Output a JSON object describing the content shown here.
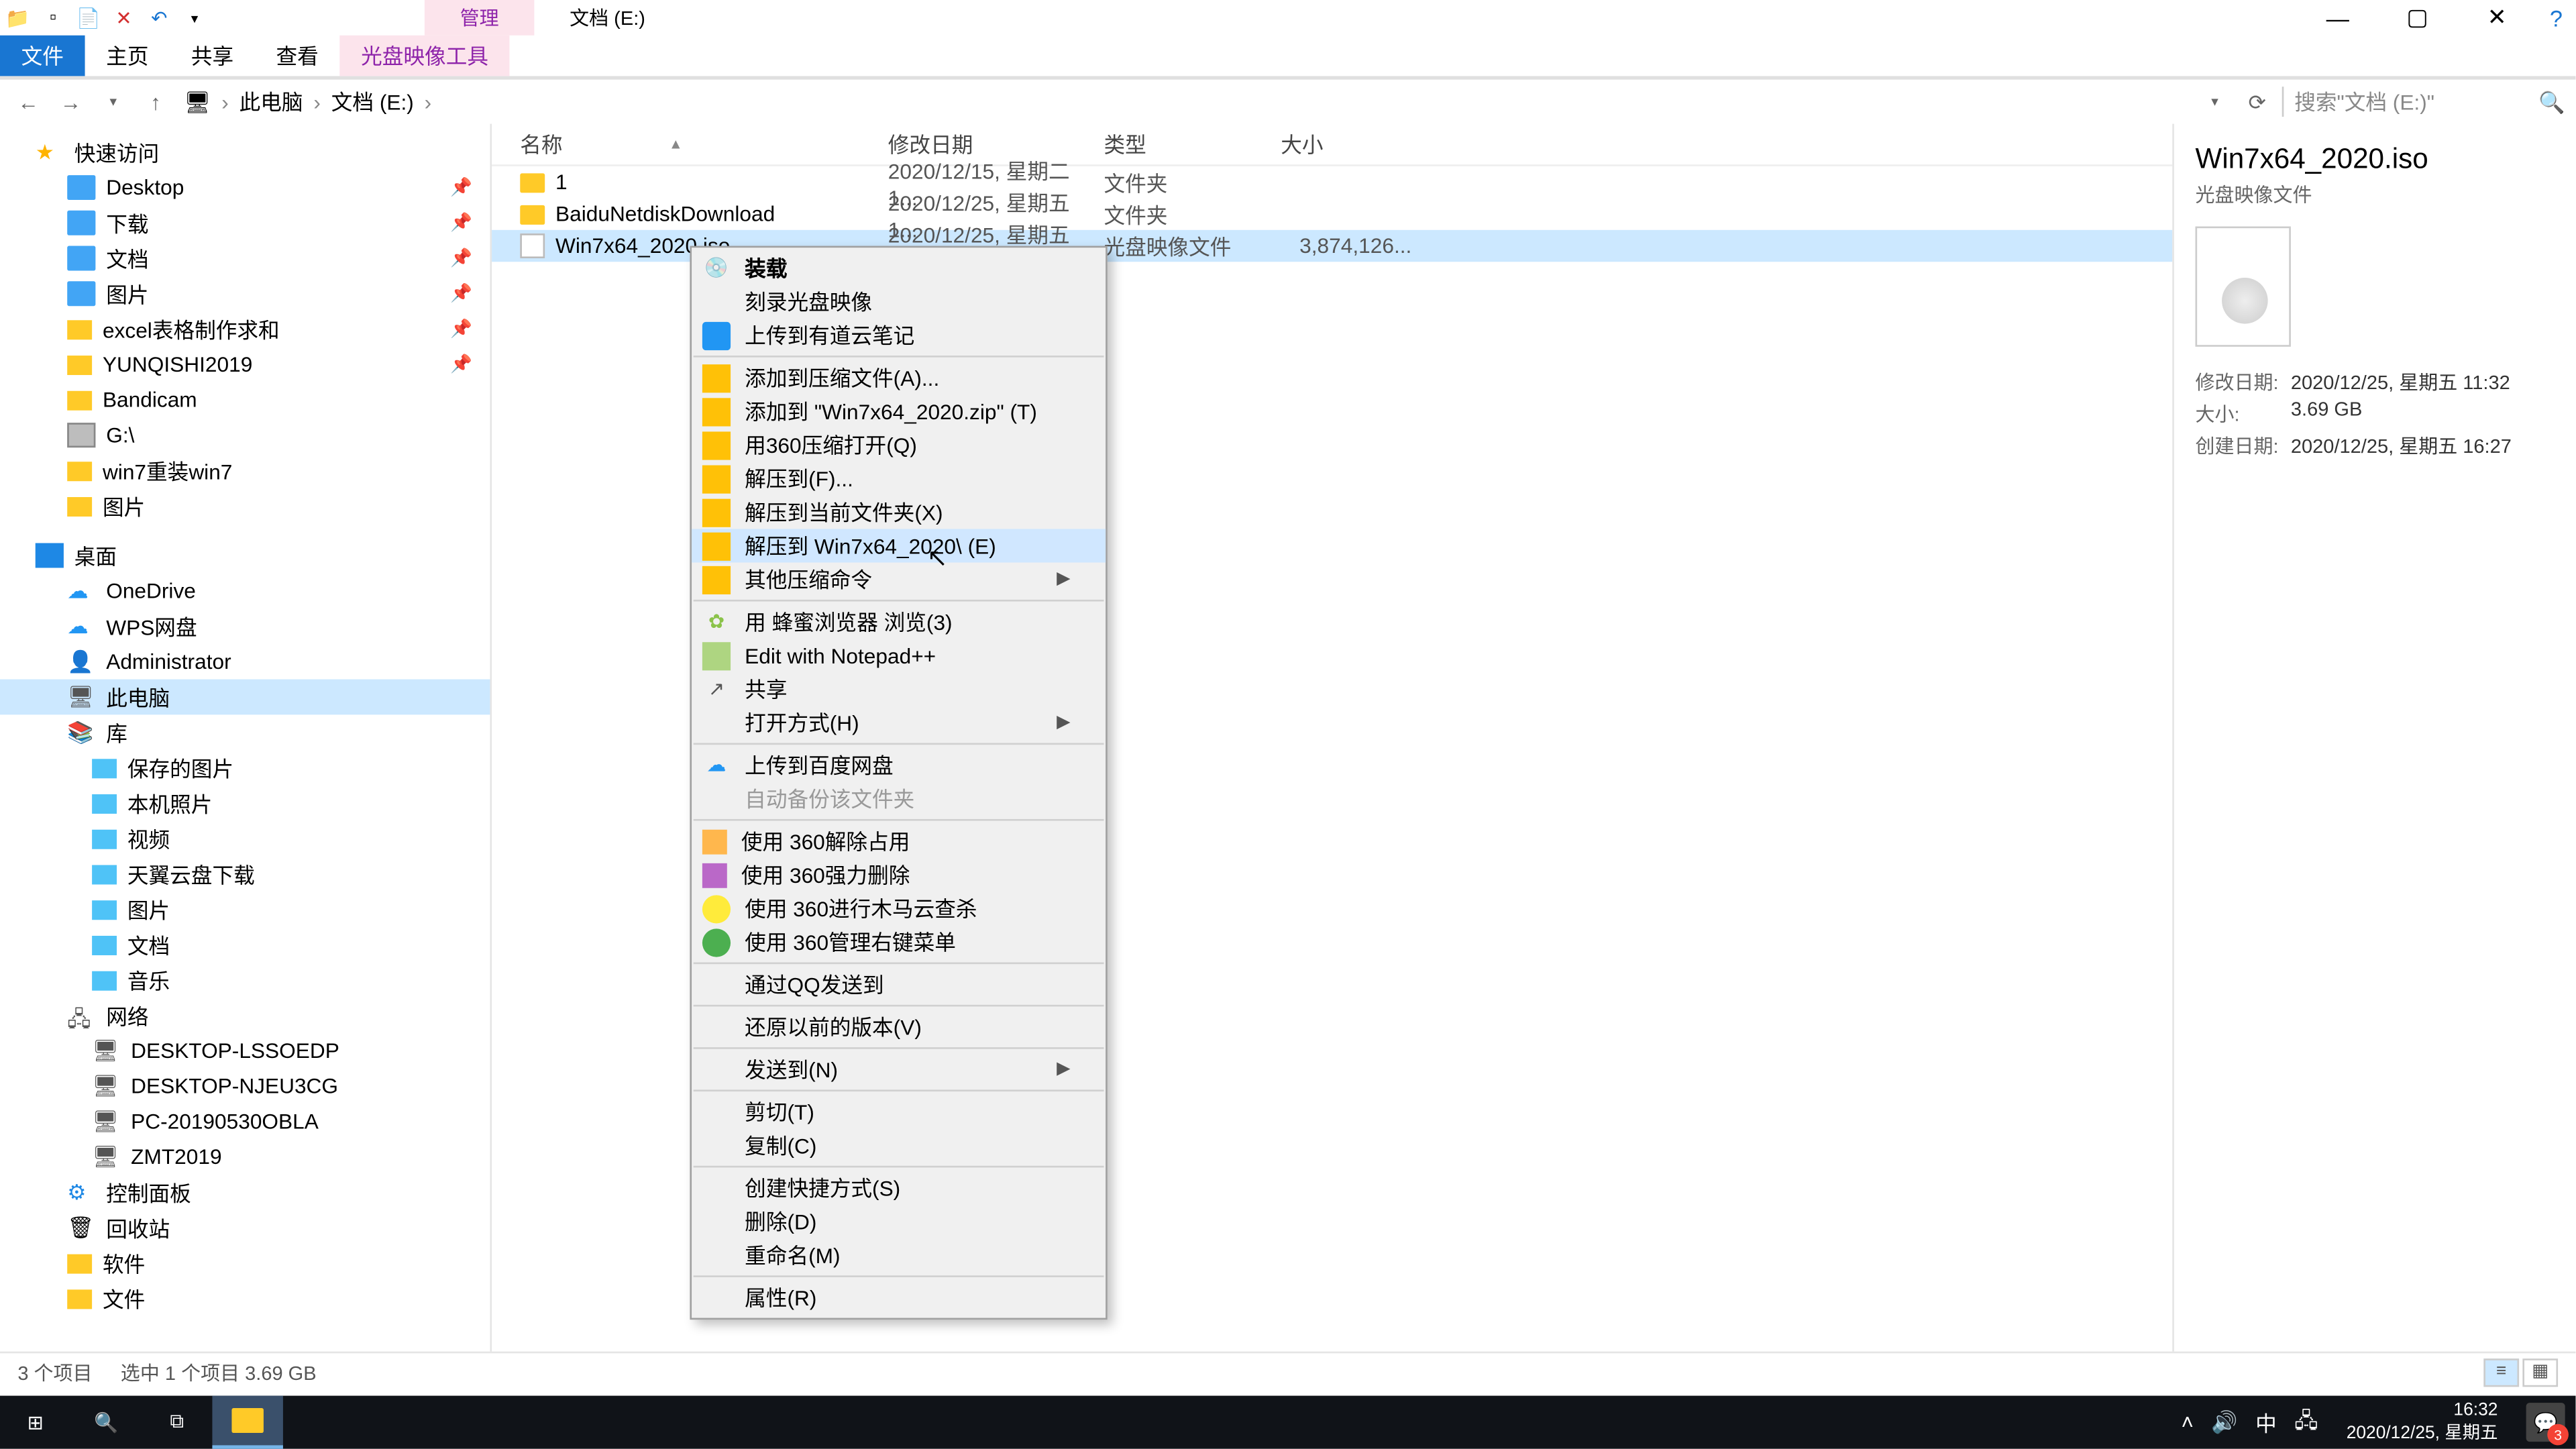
{
  "titlebar": {
    "tab_mgmt": "管理",
    "title": "文档 (E:)"
  },
  "ribbon": {
    "file": "文件",
    "home": "主页",
    "share": "共享",
    "view": "查看",
    "disc_tools": "光盘映像工具"
  },
  "addr": {
    "pc": "此电脑",
    "drive": "文档 (E:)",
    "search_ph": "搜索\"文档 (E:)\""
  },
  "cols": {
    "name": "名称",
    "date": "修改日期",
    "type": "类型",
    "size": "大小"
  },
  "rows": [
    {
      "name": "1",
      "date": "2020/12/15, 星期二 1...",
      "type": "文件夹",
      "size": ""
    },
    {
      "name": "BaiduNetdiskDownload",
      "date": "2020/12/25, 星期五 1...",
      "type": "文件夹",
      "size": ""
    },
    {
      "name": "Win7x64_2020.iso",
      "date": "2020/12/25, 星期五 1...",
      "type": "光盘映像文件",
      "size": "3,874,126..."
    }
  ],
  "nav": {
    "quick": "快速访问",
    "desktop": "Desktop",
    "downloads": "下载",
    "documents": "文档",
    "pictures1": "图片",
    "excel": "excel表格制作求和",
    "yq": "YUNQISHI2019",
    "bandicam": "Bandicam",
    "gdrive": "G:\\",
    "win7rw": "win7重装win7",
    "pictures2": "图片",
    "desk_cn": "桌面",
    "onedrive": "OneDrive",
    "wps": "WPS网盘",
    "admin": "Administrator",
    "thispc": "此电脑",
    "lib": "库",
    "saved_pic": "保存的图片",
    "cam_roll": "本机照片",
    "video": "视频",
    "tianyi": "天翼云盘下载",
    "pictures3": "图片",
    "docs2": "文档",
    "music": "音乐",
    "network": "网络",
    "pc1": "DESKTOP-LSSOEDP",
    "pc2": "DESKTOP-NJEU3CG",
    "pc3": "PC-20190530OBLA",
    "pc4": "ZMT2019",
    "ctrl": "控制面板",
    "recycle": "回收站",
    "soft": "软件",
    "files": "文件"
  },
  "details": {
    "name": "Win7x64_2020.iso",
    "type": "光盘映像文件",
    "m_k": "修改日期:",
    "m_v": "2020/12/25, 星期五 11:32",
    "s_k": "大小:",
    "s_v": "3.69 GB",
    "c_k": "创建日期:",
    "c_v": "2020/12/25, 星期五 16:27"
  },
  "status": {
    "count": "3 个项目",
    "sel": "选中 1 个项目  3.69 GB"
  },
  "ctx": {
    "mount": "装载",
    "burn": "刻录光盘映像",
    "youdao": "上传到有道云笔记",
    "addarch": "添加到压缩文件(A)...",
    "addzip": "添加到 \"Win7x64_2020.zip\" (T)",
    "open360": "用360压缩打开(Q)",
    "extractto": "解压到(F)...",
    "extracthere": "解压到当前文件夹(X)",
    "extractname": "解压到 Win7x64_2020\\ (E)",
    "othercomp": "其他压缩命令",
    "bee": "用 蜂蜜浏览器 浏览(3)",
    "npp": "Edit with Notepad++",
    "share": "共享",
    "openwith": "打开方式(H)",
    "baidu": "上传到百度网盘",
    "autobak": "自动备份该文件夹",
    "unlock": "使用 360解除占用",
    "fdel": "使用 360强力删除",
    "scan": "使用 360进行木马云查杀",
    "mgr": "使用 360管理右键菜单",
    "qq": "通过QQ发送到",
    "prev": "还原以前的版本(V)",
    "sendto": "发送到(N)",
    "cut": "剪切(T)",
    "copy": "复制(C)",
    "shortcut": "创建快捷方式(S)",
    "delete": "删除(D)",
    "rename": "重命名(M)",
    "props": "属性(R)"
  },
  "taskbar": {
    "ime": "中",
    "time": "16:32",
    "date": "2020/12/25, 星期五",
    "notif_count": "3"
  }
}
